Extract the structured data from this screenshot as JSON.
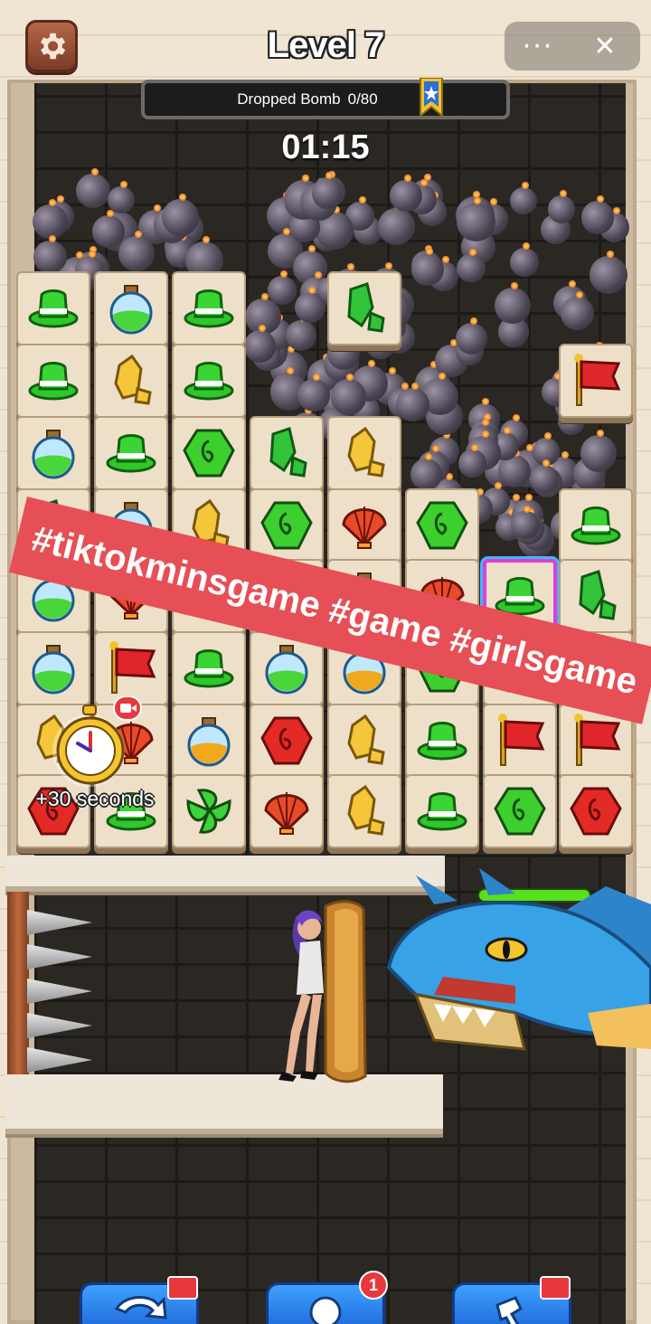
{
  "header": {
    "level_title": "Level 7",
    "settings_icon": "gear-icon",
    "more_icon": "more-dots-icon",
    "close_icon": "close-icon",
    "more_label": "···",
    "close_label": "✕"
  },
  "progress": {
    "label": "Dropped Bomb",
    "count": "0/80",
    "dropped": 0,
    "total": 80,
    "badge_icon": "bookmark-star-icon"
  },
  "timer": "01:15",
  "board": {
    "rows": [
      [
        "hat",
        "potion-green",
        "hat",
        null,
        "emerald",
        null,
        null,
        null
      ],
      [
        "hat",
        "gold",
        "hat",
        null,
        null,
        null,
        null,
        "flag"
      ],
      [
        "potion-green",
        "hat",
        "green-gem",
        "emerald",
        "gold",
        null,
        null,
        null
      ],
      [
        "emerald",
        "potion-green",
        "gold",
        "green-gem",
        "shell",
        "green-gem",
        null,
        "hat"
      ],
      [
        "potion-green",
        "shell",
        "emerald",
        "potion-green",
        "potion-orange",
        "shell",
        "hat",
        "emerald"
      ],
      [
        "potion-green",
        "flag",
        "hat",
        "potion-green",
        "potion-orange",
        "green-gem",
        "green-gem",
        "flag"
      ],
      [
        "gold",
        "shell",
        "potion-orange",
        "red-gem",
        "gold",
        "hat",
        "flag",
        "flag"
      ],
      [
        "red-gem",
        "hat",
        "leaf",
        "shell",
        "gold",
        "hat",
        "green-gem",
        "red-gem"
      ]
    ],
    "selected": [
      4,
      6
    ]
  },
  "powerup": {
    "icon": "stopwatch-icon",
    "label": "+30 seconds",
    "video_icon": "video-camera-icon"
  },
  "caption": "#tiktokminsgame #game #girlsgame",
  "dragon": {
    "health": 1.0
  },
  "toolbar": {
    "buttons": [
      {
        "icon": "shuffle-icon",
        "badge": "video-ad-icon"
      },
      {
        "icon": "hint-bulb-icon",
        "badge_count": "1"
      },
      {
        "icon": "hammer-icon",
        "badge": "video-ad-icon"
      }
    ]
  }
}
